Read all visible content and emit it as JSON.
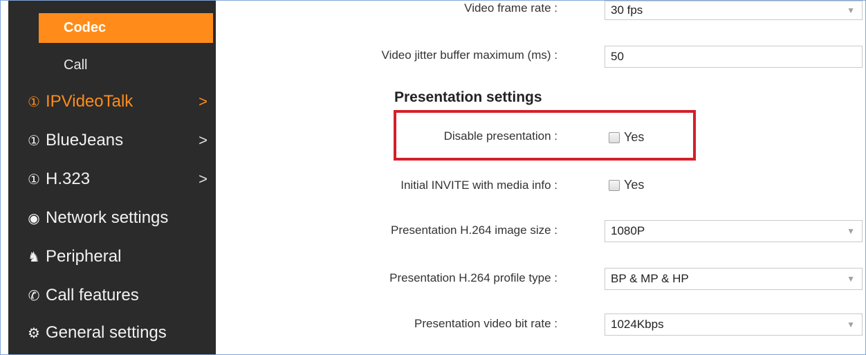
{
  "sidebar": {
    "codec_label": "Codec",
    "call_label": "Call",
    "items": [
      {
        "label": "IPVideoTalk",
        "icon": "user-circle-icon",
        "color": "#ff8c1a",
        "chevron": ">"
      },
      {
        "label": "BlueJeans",
        "icon": "user-circle-icon",
        "color": "#f2f2f2",
        "chevron": ">"
      },
      {
        "label": "H.323",
        "icon": "user-circle-icon",
        "color": "#f2f2f2",
        "chevron": ">"
      },
      {
        "label": "Network settings",
        "icon": "globe-icon",
        "color": "#f2f2f2"
      },
      {
        "label": "Peripheral",
        "icon": "peripheral-icon",
        "color": "#f2f2f2"
      },
      {
        "label": "Call features",
        "icon": "phone-icon",
        "color": "#f2f2f2"
      },
      {
        "label": "General settings",
        "icon": "gear-icon",
        "color": "#f2f2f2"
      }
    ]
  },
  "main": {
    "video_frame_rate": {
      "label": "Video frame rate :",
      "value": "30 fps"
    },
    "video_jitter": {
      "label": "Video jitter buffer maximum (ms) :",
      "value": "50"
    },
    "section_title": "Presentation settings",
    "disable_presentation": {
      "label": "Disable presentation :",
      "option": "Yes",
      "checked": false
    },
    "initial_invite": {
      "label": "Initial INVITE with media info :",
      "option": "Yes",
      "checked": false
    },
    "pres_image_size": {
      "label": "Presentation H.264 image size :",
      "value": "1080P"
    },
    "pres_profile_type": {
      "label": "Presentation H.264 profile type :",
      "value": "BP & MP & HP"
    },
    "pres_bit_rate": {
      "label": "Presentation video bit rate :",
      "value": "1024Kbps"
    }
  },
  "colors": {
    "accent": "#ff8c1a",
    "sidebar_bg": "#2b2b2b",
    "highlight": "#d3202a"
  }
}
